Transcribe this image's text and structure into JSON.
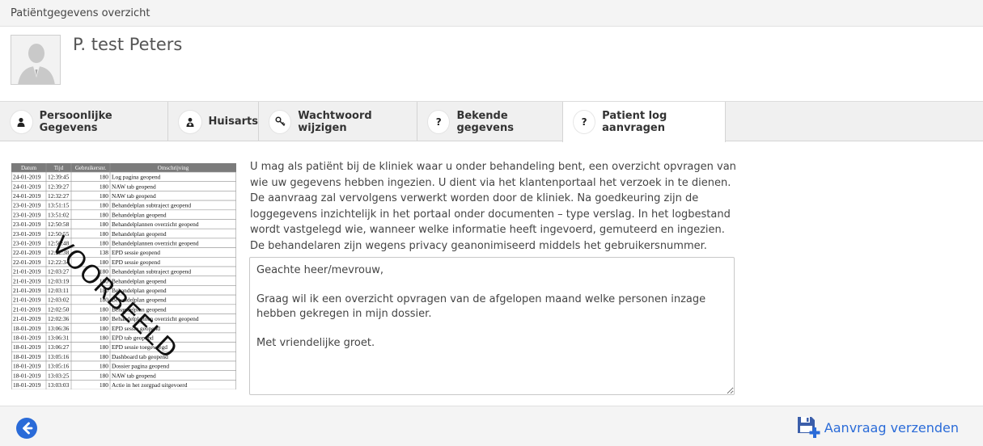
{
  "window": {
    "title": "Patiëntgegevens overzicht"
  },
  "patient": {
    "name": "P. test Peters"
  },
  "tabs": [
    {
      "label": "Persoonlijke Gegevens",
      "icon": "person-icon"
    },
    {
      "label": "Huisarts",
      "icon": "doctor-icon"
    },
    {
      "label": "Wachtwoord wijzigen",
      "icon": "key-icon"
    },
    {
      "label": "Bekende gegevens",
      "icon": "question-icon"
    },
    {
      "label": "Patient log aanvragen",
      "icon": "question-icon"
    }
  ],
  "active_tab": "Patient log aanvragen",
  "example": {
    "watermark": "VOORBEELD",
    "headers": [
      "Datum",
      "Tijd",
      "Gebruikersnr.",
      "Omschrijving"
    ],
    "rows": [
      [
        "24-01-2019",
        "12:39:45",
        "180",
        "Log pagina geopend"
      ],
      [
        "24-01-2019",
        "12:39:27",
        "180",
        "NAW tab geopend"
      ],
      [
        "24-01-2019",
        "12:32:27",
        "180",
        "NAW tab geopend"
      ],
      [
        "23-01-2019",
        "13:51:15",
        "180",
        "Behandelplan subtraject geopend"
      ],
      [
        "23-01-2019",
        "13:51:02",
        "180",
        "Behandelplan geopend"
      ],
      [
        "23-01-2019",
        "12:50:58",
        "180",
        "Behandelplannen overzicht geopend"
      ],
      [
        "23-01-2019",
        "12:50:55",
        "180",
        "Behandelplan geopend"
      ],
      [
        "23-01-2019",
        "12:50:48",
        "180",
        "Behandelplannen overzicht geopend"
      ],
      [
        "22-01-2019",
        "12:22:38",
        "138",
        "EPD sessie geopend"
      ],
      [
        "22-01-2019",
        "12:22:34",
        "180",
        "EPD sessie geopend"
      ],
      [
        "21-01-2019",
        "12:03:27",
        "180",
        "Behandelplan subtraject geopend"
      ],
      [
        "21-01-2019",
        "12:03:19",
        "180",
        "Behandelplan geopend"
      ],
      [
        "21-01-2019",
        "12:03:11",
        "180",
        "Behandelplan geopend"
      ],
      [
        "21-01-2019",
        "12:03:02",
        "180",
        "Behandelplan geopend"
      ],
      [
        "21-01-2019",
        "12:02:50",
        "180",
        "Behandelplan geopend"
      ],
      [
        "21-01-2019",
        "12:02:36",
        "180",
        "Behandelplannen overzicht geopend"
      ],
      [
        "18-01-2019",
        "13:06:36",
        "180",
        "EPD sessie geopend"
      ],
      [
        "18-01-2019",
        "13:06:31",
        "180",
        "EPD tab geopend"
      ],
      [
        "18-01-2019",
        "13:06:27",
        "180",
        "EPD sessie toegevoegd"
      ],
      [
        "18-01-2019",
        "13:05:16",
        "180",
        "Dashboard tab geopend"
      ],
      [
        "18-01-2019",
        "13:05:16",
        "180",
        "Dossier pagina geopend"
      ],
      [
        "18-01-2019",
        "13:03:25",
        "180",
        "NAW tab geopend"
      ],
      [
        "18-01-2019",
        "13:03:03",
        "180",
        "Actie in het zorgpad uitgevoerd"
      ]
    ]
  },
  "intro_text": "U mag als patiënt bij de kliniek waar u onder behandeling bent, een overzicht opvragen van wie uw gegevens hebben ingezien. U dient via het klantenportaal het verzoek in te dienen. De aanvraag zal vervolgens verwerkt worden door de kliniek. Na goedkeuring zijn de loggegevens inzichtelijk in het portaal onder documenten – type verslag. In het logbestand wordt vastgelegd wie, wanneer welke informatie heeft ingevoerd, gemuteerd en ingezien. De behandelaren zijn wegens privacy geanonimiseerd middels het gebruikersnummer.",
  "message": "Geachte heer/mevrouw,\n\nGraag wil ik een overzicht opvragen van de afgelopen maand welke personen inzage hebben gekregen in mijn dossier.\n\nMet vriendelijke groet.",
  "footer": {
    "send_label": "Aanvraag verzenden",
    "back_icon": "back-arrow-icon",
    "send_icon": "save-plus-icon"
  },
  "colors": {
    "accent": "#2a6bd8",
    "table_header": "#7b7b7b"
  }
}
